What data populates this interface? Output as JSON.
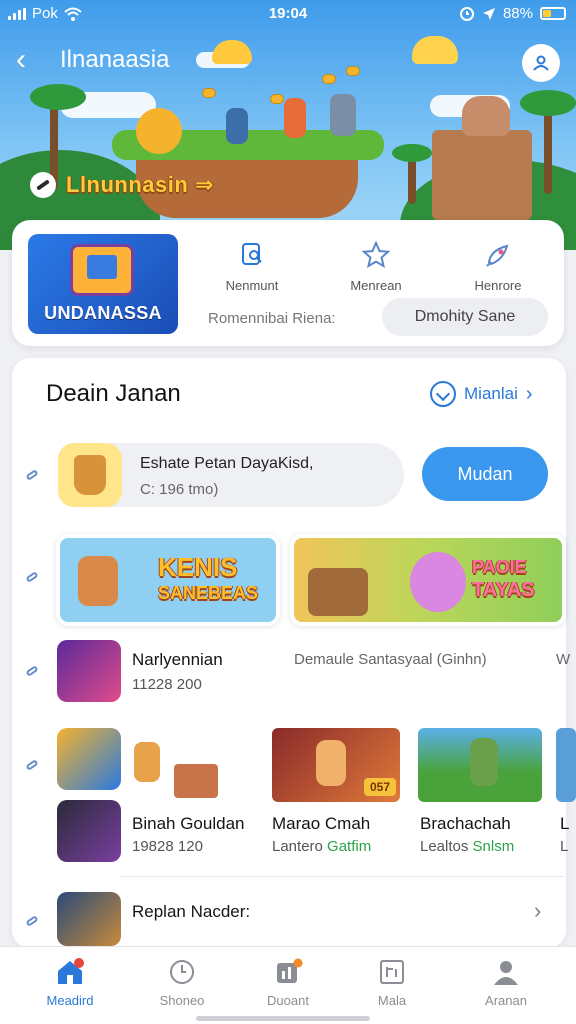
{
  "status_bar": {
    "carrier": "Pok",
    "time": "19:04",
    "battery": "88%"
  },
  "header": {
    "back": "‹",
    "title": "Ilnanaasia"
  },
  "hero": {
    "caption": "Llnunnasin ⇒"
  },
  "promo": {
    "game_name": "UNDANASSA",
    "quick_actions": [
      {
        "label": "Nenmunt",
        "icon": "bookmark-icon"
      },
      {
        "label": "Menrean",
        "icon": "star-icon"
      },
      {
        "label": "Henrore",
        "icon": "rocket-icon"
      }
    ],
    "subtitle": "Romennibai Riena:",
    "pill_button": "Dmohity Sane"
  },
  "section": {
    "title": "Deain Janan",
    "more_label": "Mianlai",
    "more_chevron": "›",
    "featured": {
      "title": "Eshate Petan DayaKisd,",
      "meta": "C: 196 tmo)",
      "action": "Mudan"
    },
    "banners": [
      {
        "text_line1": "KENIS",
        "text_line2": "SANEBEAS"
      },
      {
        "text_line1": "PAOIE",
        "text_line2": "TAYAS"
      }
    ],
    "list_row_1": {
      "name": "Narlyennian",
      "meta": "11228 200",
      "desc": "Demaule Santasyaal (Ginhn)",
      "tail": "W"
    },
    "list_row_2": {
      "items": [
        {
          "name": "Binah Gouldan",
          "meta": "19828 120"
        },
        {
          "name": "Marao Cmah",
          "meta_prefix": "Lantero",
          "meta_green": "Gatfim",
          "badge": "057"
        },
        {
          "name": "Brachachah",
          "meta_prefix": "Lealtos",
          "meta_green": "Snlsm"
        }
      ],
      "tail_name": "L",
      "tail_meta": "L"
    },
    "list_row_3": {
      "name": "Replan Nacder:",
      "chevron": "›"
    }
  },
  "tabs": [
    {
      "label": "Meadird",
      "active": true,
      "icon": "home-icon"
    },
    {
      "label": "Shoneo",
      "active": false,
      "icon": "clock-icon"
    },
    {
      "label": "Duoant",
      "active": false,
      "icon": "chart-icon"
    },
    {
      "label": "Mala",
      "active": false,
      "icon": "image-icon"
    },
    {
      "label": "Aranan",
      "active": false,
      "icon": "person-icon"
    }
  ],
  "colors": {
    "accent": "#2a78d9",
    "button_blue": "#3a97ee",
    "green_text": "#2ca34a"
  }
}
